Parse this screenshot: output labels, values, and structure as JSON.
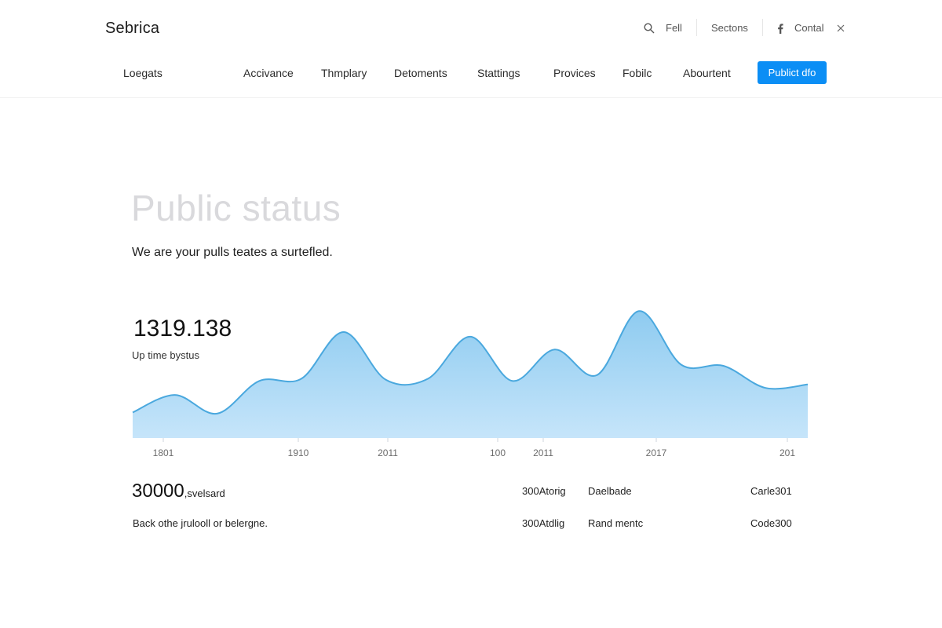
{
  "header": {
    "brand": "Sebrica",
    "utility": [
      {
        "icon": "search-icon",
        "label": "Fell"
      },
      {
        "icon": "",
        "label": "Sectons"
      },
      {
        "icon": "facebook-icon",
        "label": "Contal"
      }
    ],
    "close_icon": "close-icon"
  },
  "nav": {
    "first": "Loegats",
    "items": [
      "Accivance",
      "Thmplary",
      "Detoments",
      "Stattings",
      "Provices",
      "Fobilc",
      "Abourtent"
    ],
    "cta": "Publict dfo"
  },
  "hero": {
    "title": "Public status",
    "subtitle": "We are your pulls teates a surtefled."
  },
  "metric": {
    "value": "1319.138",
    "label": "Up time bystus"
  },
  "chart_data": {
    "type": "area",
    "title": "",
    "xlabel": "",
    "ylabel": "",
    "x_tick_labels": [
      "1801",
      "1910",
      "2011",
      "100",
      "2011",
      "2017",
      "201"
    ],
    "values": [
      22,
      37,
      21,
      49,
      51,
      91,
      50,
      51,
      87,
      49,
      76,
      54,
      109,
      63,
      62,
      43,
      46
    ],
    "ylim": [
      0,
      120
    ],
    "grid": false,
    "legend": "none",
    "fill_color": "#aed8f4",
    "line_color": "#4aa8de"
  },
  "stats": {
    "row1": {
      "big": "30000",
      "suffix": ",svelsard",
      "c1": "300Atorig",
      "c2": "Daelbade",
      "c3": "Carle301"
    },
    "row2": {
      "left": "Back othe jrulooll or belergne.",
      "c1": "300Atdlig",
      "c2": "Rand mentc",
      "c3": "Code300"
    }
  }
}
